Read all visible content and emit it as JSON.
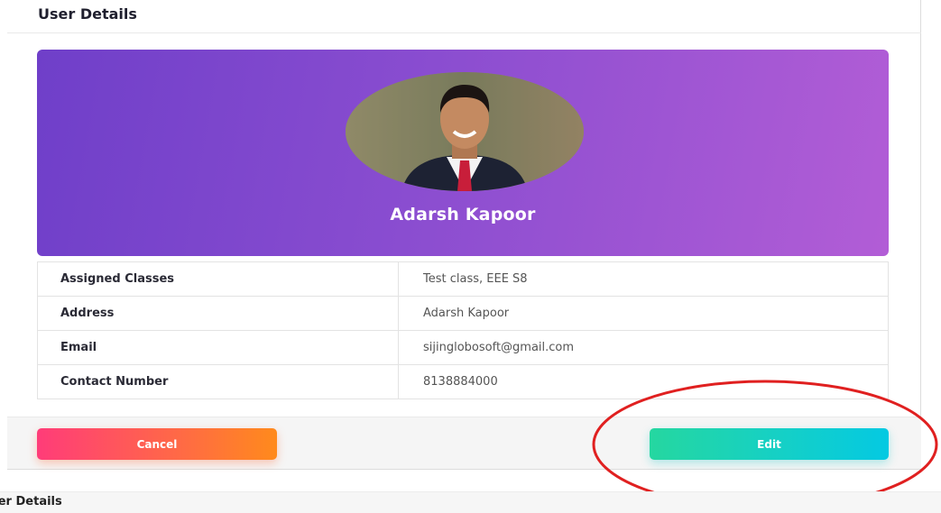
{
  "modal": {
    "title": "User Details"
  },
  "profile": {
    "name": "Adarsh Kapoor",
    "gradient_start": "#6f3fc9",
    "gradient_end": "#b25dd6"
  },
  "details": [
    {
      "label": "Assigned Classes",
      "value": "Test class, EEE S8"
    },
    {
      "label": "Address",
      "value": "Adarsh Kapoor"
    },
    {
      "label": "Email",
      "value": "sijinglobosoft@gmail.com"
    },
    {
      "label": "Contact Number",
      "value": "8138884000"
    }
  ],
  "footer": {
    "cancel_label": "Cancel",
    "edit_label": "Edit"
  },
  "annotation": {
    "color": "#e02020",
    "target": "Edit"
  },
  "background_page": {
    "title": "ser Details"
  }
}
